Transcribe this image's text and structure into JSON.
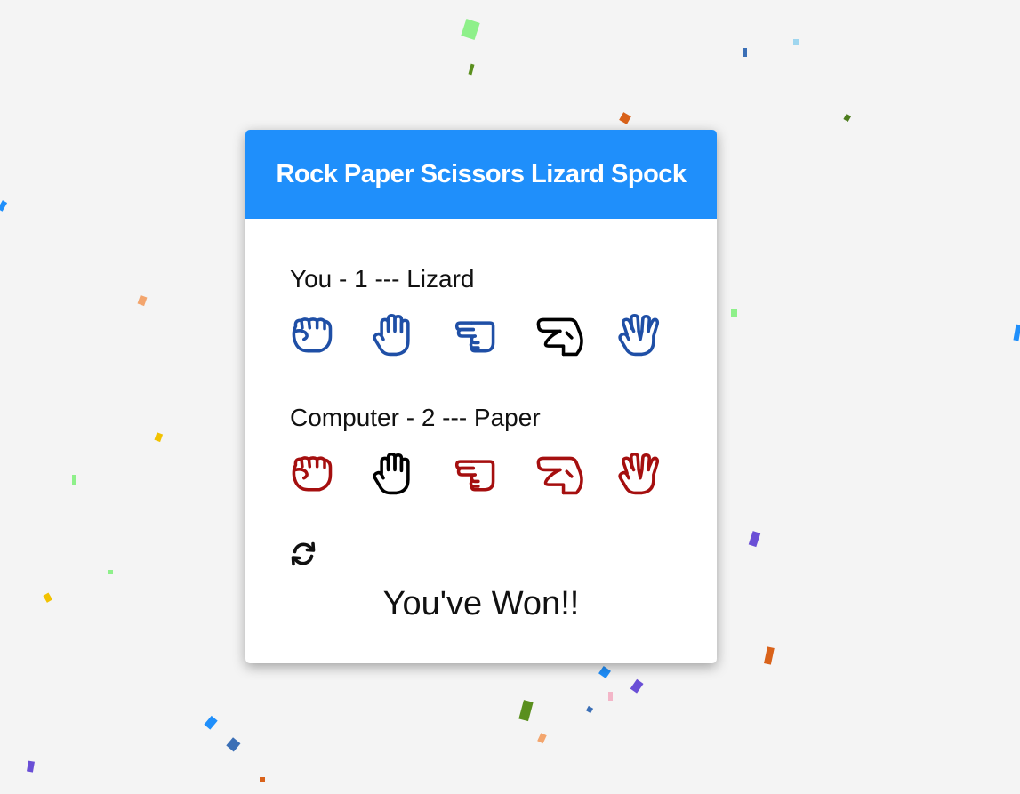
{
  "app": {
    "title": "Rock Paper Scissors Lizard Spock"
  },
  "colors": {
    "header": "#1f8ffb",
    "player": "#1f4fa6",
    "computer": "#a50f0f",
    "selected": "#000000"
  },
  "moves": [
    "rock",
    "paper",
    "scissors",
    "lizard",
    "spock"
  ],
  "player": {
    "label": "You - 1 --- Lizard",
    "selected": "lizard"
  },
  "computer": {
    "label": "Computer - 2 --- Paper",
    "selected": "paper"
  },
  "reset": {
    "icon": "refresh-icon"
  },
  "result": {
    "text": "You've Won!!"
  }
}
